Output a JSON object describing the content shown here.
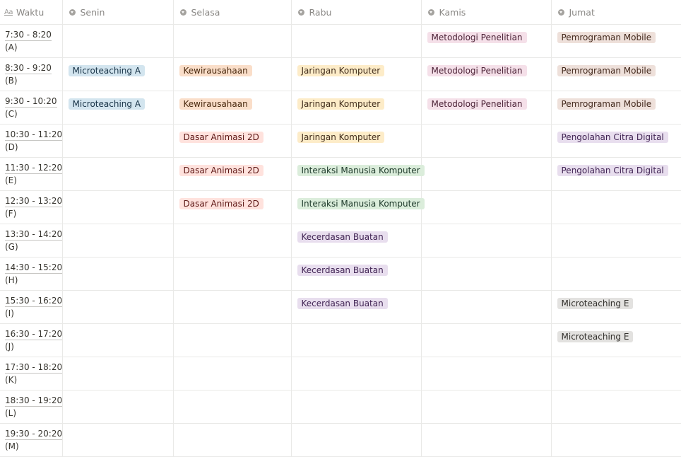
{
  "header": {
    "columns": [
      {
        "label": "Waktu",
        "icon": "text-property-icon"
      },
      {
        "label": "Senin",
        "icon": "select-property-icon"
      },
      {
        "label": "Selasa",
        "icon": "select-property-icon"
      },
      {
        "label": "Rabu",
        "icon": "select-property-icon"
      },
      {
        "label": "Kamis",
        "icon": "select-property-icon"
      },
      {
        "label": "Jumat",
        "icon": "select-property-icon"
      }
    ]
  },
  "colors": {
    "blue": "#d3e5ef",
    "orange": "#fadec9",
    "yellow": "#fdecc8",
    "pink": "#f5e0e9",
    "brown": "#eee0da",
    "red": "#ffe2dd",
    "green": "#dbeddb",
    "purple": "#e8deee",
    "gray": "#e3e2e0"
  },
  "rows": [
    {
      "time": "7:30 - 8:20",
      "code": "(A)",
      "senin": "",
      "selasa": "",
      "rabu": "",
      "kamis": "Metodologi Penelitian",
      "jumat": "Pemrograman Mobile"
    },
    {
      "time": "8:30 - 9:20",
      "code": "(B)",
      "senin": "Microteaching A",
      "selasa": "Kewirausahaan",
      "rabu": "Jaringan Komputer",
      "kamis": "Metodologi Penelitian",
      "jumat": "Pemrograman Mobile"
    },
    {
      "time": "9:30 - 10:20",
      "code": "(C)",
      "senin": "Microteaching A",
      "selasa": "Kewirausahaan",
      "rabu": "Jaringan Komputer",
      "kamis": "Metodologi Penelitian",
      "jumat": "Pemrograman Mobile"
    },
    {
      "time": "10:30 - 11:20",
      "code": "(D)",
      "senin": "",
      "selasa": "Dasar Animasi 2D",
      "rabu": "Jaringan Komputer",
      "kamis": "",
      "jumat": "Pengolahan Citra Digital"
    },
    {
      "time": "11:30 - 12:20",
      "code": "(E)",
      "senin": "",
      "selasa": "Dasar Animasi 2D",
      "rabu": "Interaksi Manusia Komputer",
      "kamis": "",
      "jumat": "Pengolahan Citra Digital"
    },
    {
      "time": "12:30 - 13:20",
      "code": "(F)",
      "senin": "",
      "selasa": "Dasar Animasi 2D",
      "rabu": "Interaksi Manusia Komputer",
      "kamis": "",
      "jumat": ""
    },
    {
      "time": "13:30 - 14:20",
      "code": "(G)",
      "senin": "",
      "selasa": "",
      "rabu": "Kecerdasan Buatan",
      "kamis": "",
      "jumat": ""
    },
    {
      "time": "14:30 - 15:20",
      "code": "(H)",
      "senin": "",
      "selasa": "",
      "rabu": "Kecerdasan Buatan",
      "kamis": "",
      "jumat": ""
    },
    {
      "time": "15:30 - 16:20",
      "code": "(I)",
      "senin": "",
      "selasa": "",
      "rabu": "Kecerdasan Buatan",
      "kamis": "",
      "jumat": "Microteaching E"
    },
    {
      "time": "16:30 - 17:20",
      "code": "(J)",
      "senin": "",
      "selasa": "",
      "rabu": "",
      "kamis": "",
      "jumat": "Microteaching E"
    },
    {
      "time": "17:30 - 18:20",
      "code": "(K)",
      "senin": "",
      "selasa": "",
      "rabu": "",
      "kamis": "",
      "jumat": ""
    },
    {
      "time": "18:30 - 19:20",
      "code": "(L)",
      "senin": "",
      "selasa": "",
      "rabu": "",
      "kamis": "",
      "jumat": ""
    },
    {
      "time": "19:30 - 20:20",
      "code": "(M)",
      "senin": "",
      "selasa": "",
      "rabu": "",
      "kamis": "",
      "jumat": ""
    }
  ]
}
